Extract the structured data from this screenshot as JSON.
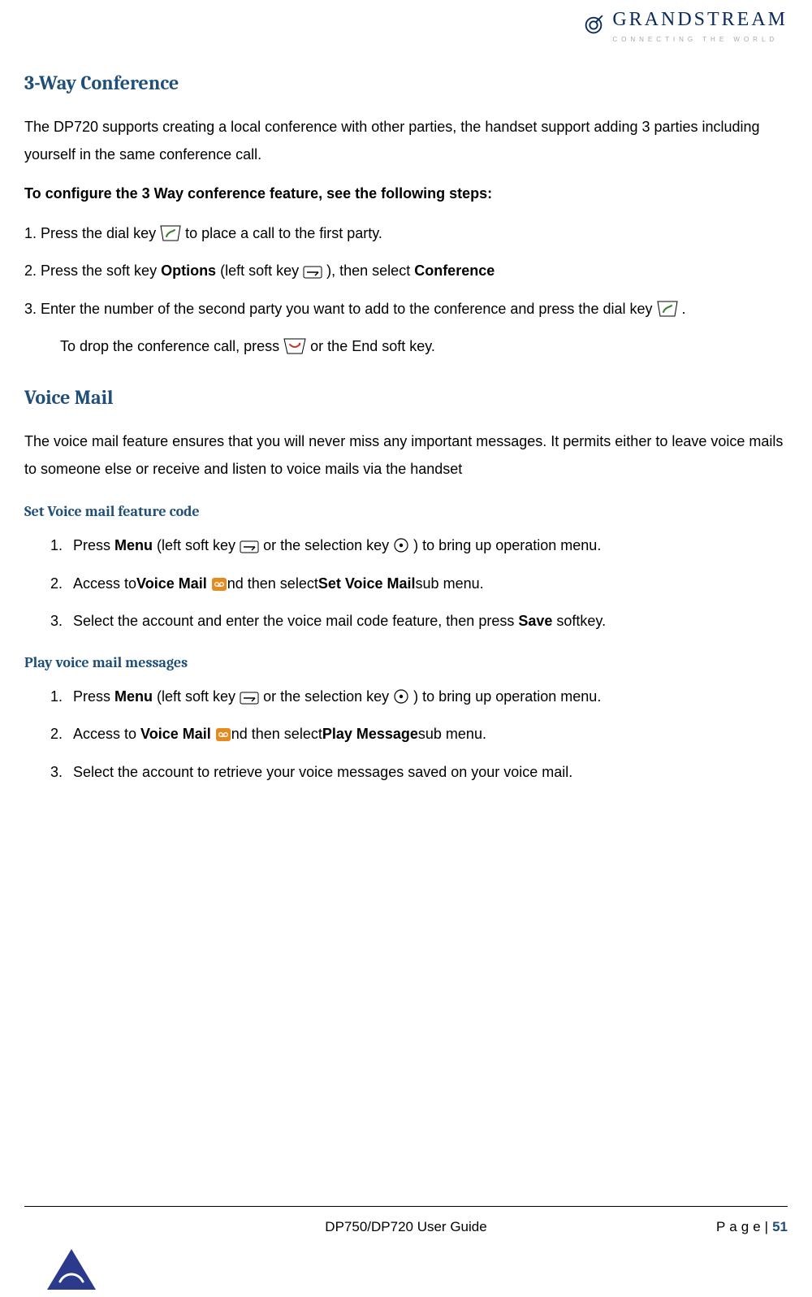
{
  "brand": {
    "name": "GRANDSTREAM",
    "tagline": "CONNECTING THE WORLD"
  },
  "section1": {
    "title": "3-Way Conference",
    "intro": "The DP720 supports creating a local conference with other parties, the handset support adding 3 parties including yourself in the same conference call.",
    "config_line": "To configure the 3 Way conference feature, see the following steps:",
    "step1_a": "1. Press the dial key ",
    "step1_b": " to place a call to the first party.",
    "step2_a": "2. Press the soft key ",
    "step2_bold1": "Options",
    "step2_b": " (left soft key ",
    "step2_c": " ), then select ",
    "step2_bold2": "Conference",
    "step3_a": "3. Enter the number of the second party you want to add to the conference and press the dial key",
    "step3_b": " .",
    "step3_drop_a": "To drop the conference call, press  ",
    "step3_drop_b": "  or the End soft key."
  },
  "section2": {
    "title": "Voice Mail",
    "intro": "The voice mail feature ensures that you will never miss any important messages. It permits either to leave voice mails to someone else or receive and listen to voice mails via the handset",
    "sub1": {
      "title": "Set Voice mail feature code",
      "s1_a": "Press ",
      "s1_bold1": "Menu",
      "s1_b": " (left soft key ",
      "s1_c": " or the selection key",
      "s1_d": " ) to bring up operation menu.",
      "s2_a": "Access to",
      "s2_bold1": "Voice Mail",
      "s2_b": "  ",
      "s2_c": "nd then select",
      "s2_bold2": "Set Voice Mail",
      "s2_d": "sub menu.",
      "s3_a": "Select the account and enter the voice mail code feature, then press ",
      "s3_bold1": "Save",
      "s3_b": " softkey."
    },
    "sub2": {
      "title": "Play voice mail messages",
      "s1_a": "Press ",
      "s1_bold1": "Menu",
      "s1_b": " (left soft key ",
      "s1_c": " or the selection key",
      "s1_d": " ) to bring up operation menu.",
      "s2_a": "Access to ",
      "s2_bold1": "Voice Mail",
      "s2_b": " ",
      "s2_c": "nd then select",
      "s2_bold2": "Play Message",
      "s2_d": "sub menu.",
      "s3": "Select the account to retrieve your voice messages saved on your voice mail."
    }
  },
  "footer": {
    "doc_title": "DP750/DP720 User Guide",
    "page_label": "Page|",
    "page_num": "51"
  }
}
